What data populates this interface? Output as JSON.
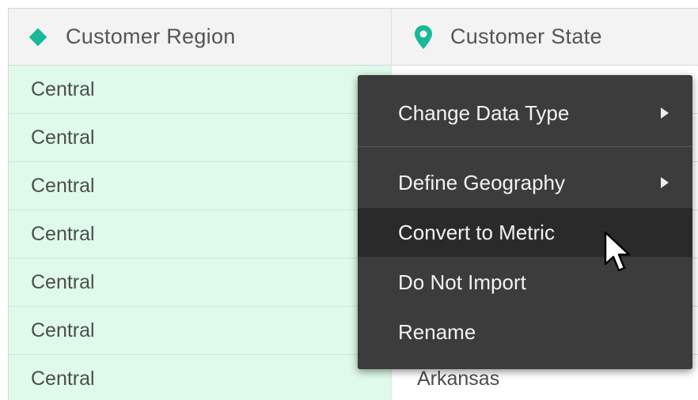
{
  "table": {
    "headers": {
      "region": "Customer Region",
      "state": "Customer State"
    },
    "header_icons": {
      "region": "diamond-icon",
      "state": "map-pin-icon"
    },
    "rows": [
      {
        "region": "Central",
        "state": ""
      },
      {
        "region": "Central",
        "state": ""
      },
      {
        "region": "Central",
        "state": ""
      },
      {
        "region": "Central",
        "state": ""
      },
      {
        "region": "Central",
        "state": ""
      },
      {
        "region": "Central",
        "state": ""
      },
      {
        "region": "Central",
        "state": "Arkansas"
      }
    ]
  },
  "context_menu": {
    "items": [
      {
        "label": "Change Data Type",
        "submenu": true
      },
      {
        "label": "Define Geography",
        "submenu": true
      },
      {
        "label": "Convert to Metric",
        "submenu": false,
        "hovered": true
      },
      {
        "label": "Do Not Import",
        "submenu": false
      },
      {
        "label": "Rename",
        "submenu": false
      }
    ]
  },
  "colors": {
    "accent_teal": "#18b89a",
    "row_highlight": "#dffaea",
    "menu_background": "#3c3c3c",
    "menu_hover": "#2a2a2a"
  }
}
